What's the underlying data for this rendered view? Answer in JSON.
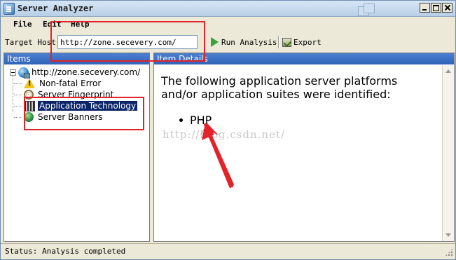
{
  "window": {
    "title": "Server Analyzer"
  },
  "menu": {
    "file": "File",
    "edit": "Edit",
    "help": "Help"
  },
  "toolbar": {
    "target_label": "Target Host:",
    "target_value": "http://zone.secevery.com/",
    "run_label": "Run Analysis",
    "export_label": "Export"
  },
  "left_pane": {
    "header": "Items",
    "root": "http://zone.secevery.com/",
    "items": [
      {
        "label": "Non-fatal Error",
        "icon": "warning-icon"
      },
      {
        "label": "Server Fingerprint",
        "icon": "fingerprint-icon"
      },
      {
        "label": "Application Technology",
        "icon": "application-technology-icon",
        "selected": true
      },
      {
        "label": "Server Banners",
        "icon": "globe-icon"
      }
    ]
  },
  "right_pane": {
    "header": "Item Details",
    "description": "The following application server platforms and/or application suites were identified:",
    "results": [
      "PHP"
    ]
  },
  "status": {
    "text": "Status: Analysis completed"
  },
  "watermark": "http://blog.csdn.net/",
  "colors": {
    "selection": "#0a246a",
    "pane_header": "#3a6fc4",
    "annotation": "#e4222a"
  }
}
